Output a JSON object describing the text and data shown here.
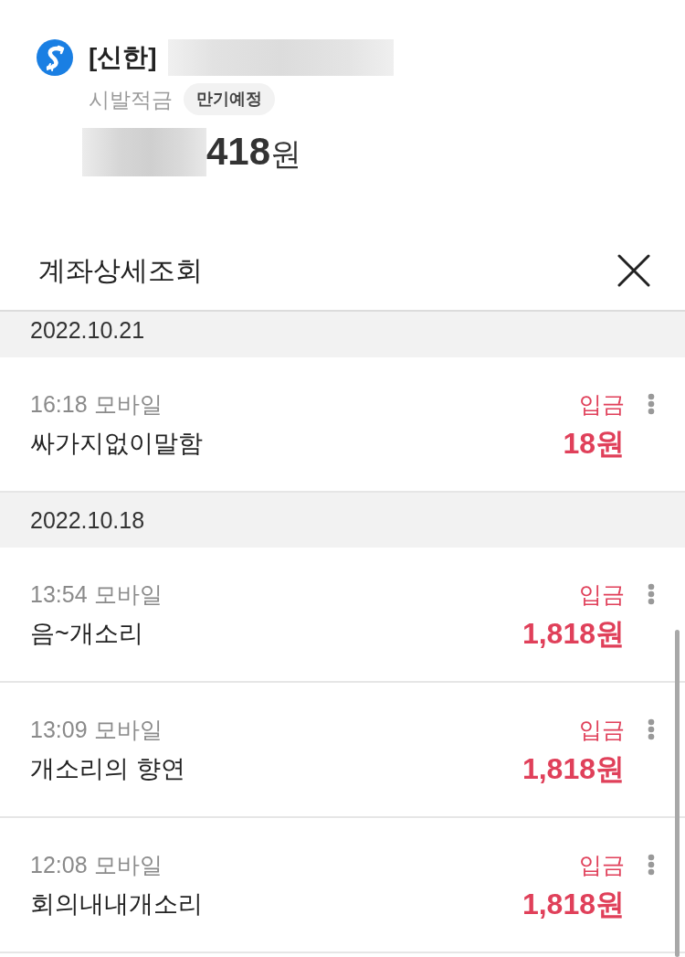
{
  "account": {
    "bank_label": "[신한]",
    "number_redacted": true,
    "product_name": "시발적금",
    "badge": "만기예정",
    "balance_redacted": true,
    "balance": "**418**원"
  },
  "panel": {
    "title": "계좌상세조회"
  },
  "groups": [
    {
      "date": "2022.10.21",
      "items": [
        {
          "time": "16:18 모바일",
          "memo": "싸가지없이말함",
          "type": "입금",
          "amount": "18원"
        }
      ]
    },
    {
      "date": "2022.10.18",
      "items": [
        {
          "time": "13:54 모바일",
          "memo": "음~개소리",
          "type": "입금",
          "amount": "1,818원"
        },
        {
          "time": "13:09 모바일",
          "memo": "개소리의 향연",
          "type": "입금",
          "amount": "1,818원"
        },
        {
          "time": "12:08 모바일",
          "memo": "회의내내개소리",
          "type": "입금",
          "amount": "1,818원"
        }
      ]
    }
  ]
}
